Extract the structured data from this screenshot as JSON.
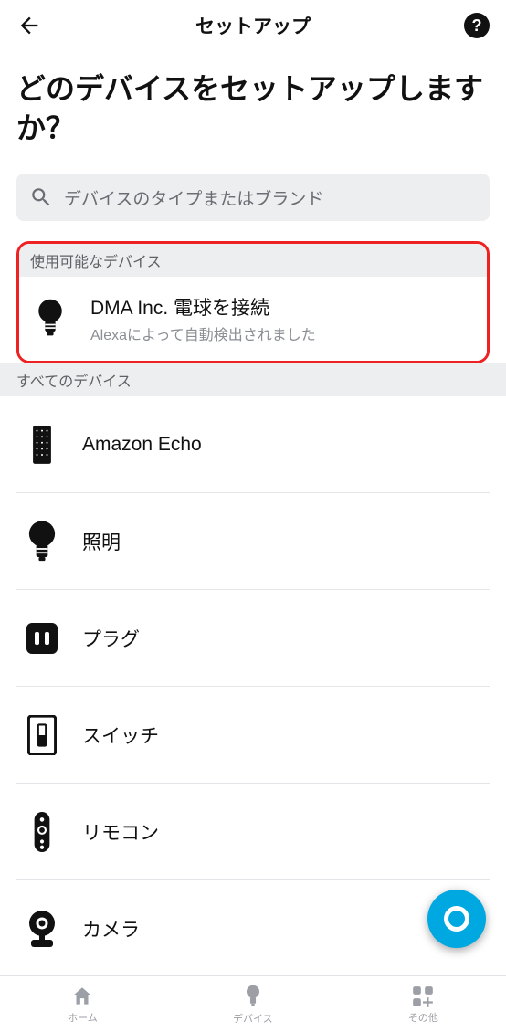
{
  "header": {
    "title": "セットアップ"
  },
  "page": {
    "heading": "どのデバイスをセットアップしますか？"
  },
  "search": {
    "placeholder": "デバイスのタイプまたはブランド"
  },
  "sections": {
    "available_label": "使用可能なデバイス",
    "all_label": "すべてのデバイス"
  },
  "available_device": {
    "title": "DMA Inc. 電球を接続",
    "subtitle": "Alexaによって自動検出されました"
  },
  "devices": [
    {
      "label": "Amazon Echo",
      "icon": "echo"
    },
    {
      "label": "照明",
      "icon": "bulb"
    },
    {
      "label": "プラグ",
      "icon": "plug"
    },
    {
      "label": "スイッチ",
      "icon": "switch"
    },
    {
      "label": "リモコン",
      "icon": "remote"
    },
    {
      "label": "カメラ",
      "icon": "camera"
    }
  ],
  "nav": {
    "home": "ホーム",
    "devices": "デバイス",
    "more": "その他"
  }
}
